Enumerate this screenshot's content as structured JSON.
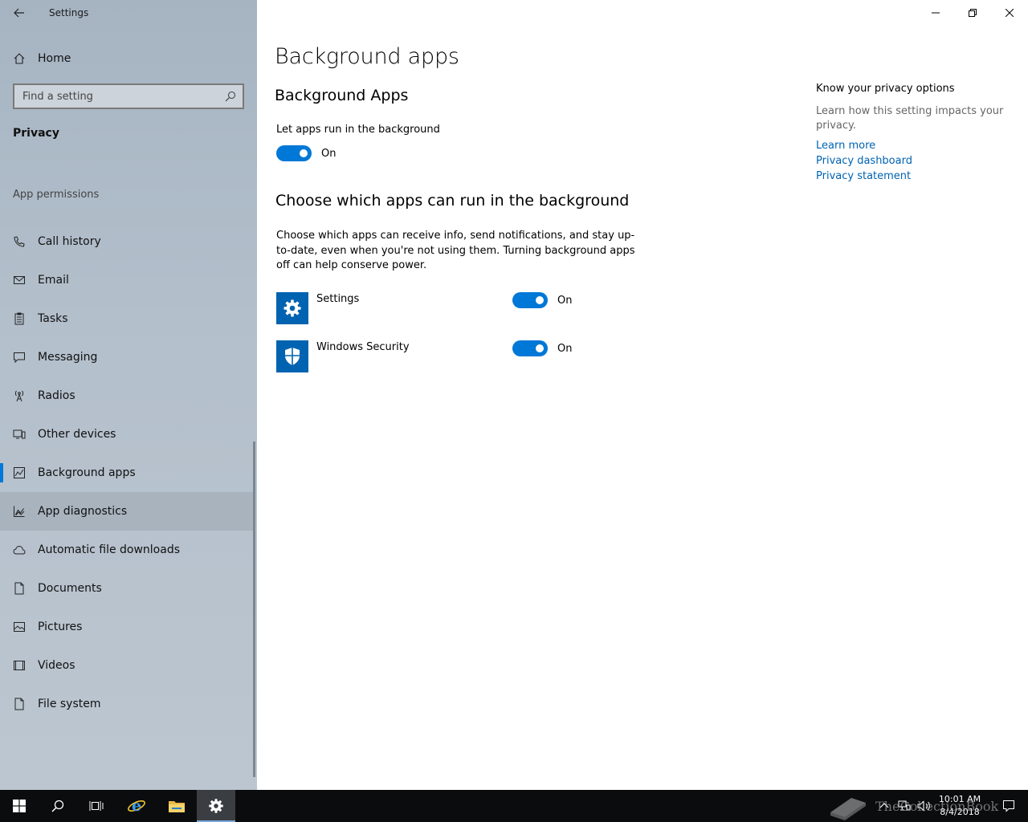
{
  "window": {
    "app_title": "Settings"
  },
  "sidebar": {
    "home_label": "Home",
    "search_placeholder": "Find a setting",
    "section_title": "Privacy",
    "group_title": "App permissions",
    "items": [
      {
        "label": "Call history",
        "icon": "call-history-icon"
      },
      {
        "label": "Email",
        "icon": "email-icon"
      },
      {
        "label": "Tasks",
        "icon": "tasks-icon"
      },
      {
        "label": "Messaging",
        "icon": "messaging-icon"
      },
      {
        "label": "Radios",
        "icon": "radios-icon"
      },
      {
        "label": "Other devices",
        "icon": "other-devices-icon"
      },
      {
        "label": "Background apps",
        "icon": "background-apps-icon",
        "active": true
      },
      {
        "label": "App diagnostics",
        "icon": "app-diagnostics-icon",
        "hover": true
      },
      {
        "label": "Automatic file downloads",
        "icon": "cloud-icon"
      },
      {
        "label": "Documents",
        "icon": "document-icon"
      },
      {
        "label": "Pictures",
        "icon": "pictures-icon"
      },
      {
        "label": "Videos",
        "icon": "videos-icon"
      },
      {
        "label": "File system",
        "icon": "file-system-icon"
      }
    ]
  },
  "main": {
    "page_title": "Background apps",
    "section1_title": "Background Apps",
    "let_apps_label": "Let apps run in the background",
    "let_apps_state": "On",
    "section2_title": "Choose which apps can run in the background",
    "description": "Choose which apps can receive info, send notifications, and stay up-to-date, even when you're not using them. Turning background apps off can help conserve power.",
    "apps": [
      {
        "name": "Settings",
        "state": "On",
        "icon": "gear-icon"
      },
      {
        "name": "Windows Security",
        "state": "On",
        "icon": "shield-icon"
      }
    ]
  },
  "right_pane": {
    "title": "Know your privacy options",
    "description": "Learn how this setting impacts your privacy.",
    "links": [
      "Learn more",
      "Privacy dashboard",
      "Privacy statement"
    ]
  },
  "taskbar": {
    "time": "10:01 AM",
    "date": "8/4/2018",
    "watermark": "TheCollectionBook"
  },
  "colors": {
    "accent": "#0078d7",
    "link": "#0063b1",
    "app_tile": "#0063b1",
    "taskbar": "#0b0c0e"
  }
}
